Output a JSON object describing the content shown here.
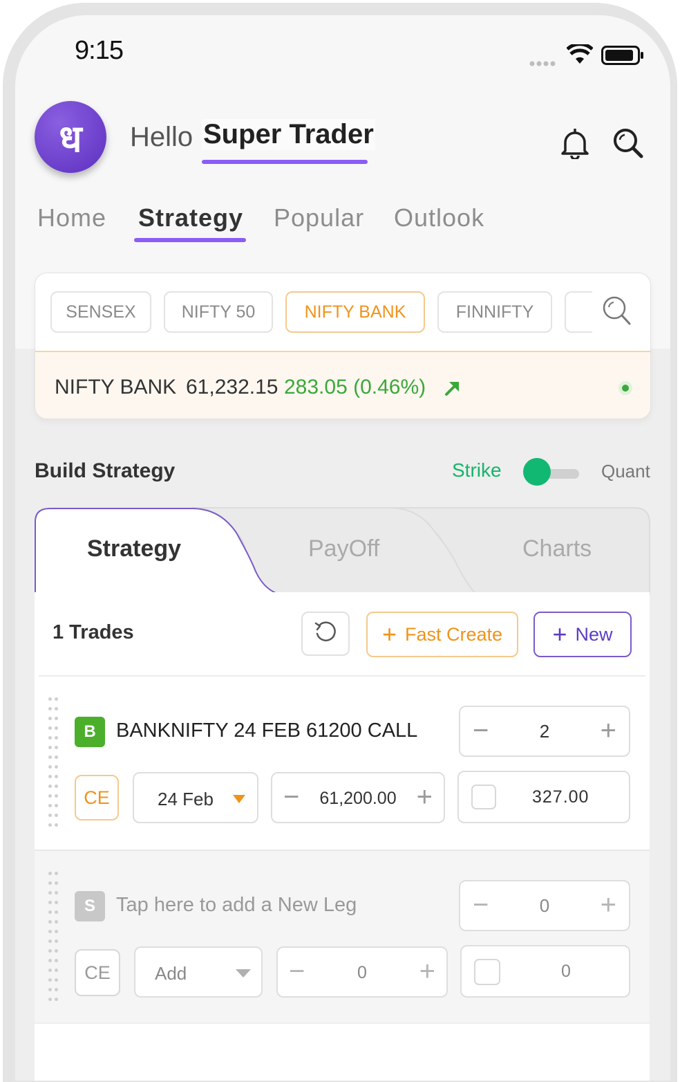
{
  "status_bar": {
    "time": "9:15"
  },
  "header": {
    "avatar_letter": "ध",
    "greeting": "Hello",
    "user_name": "Super Trader"
  },
  "nav": {
    "tabs": [
      {
        "label": "Home",
        "active": false
      },
      {
        "label": "Strategy",
        "active": true
      },
      {
        "label": "Popular",
        "active": false
      },
      {
        "label": "Outlook",
        "active": false
      }
    ]
  },
  "indices": {
    "chips": [
      {
        "label": "SENSEX",
        "active": false
      },
      {
        "label": "NIFTY 50",
        "active": false
      },
      {
        "label": "NIFTY BANK",
        "active": true
      },
      {
        "label": "FINNIFTY",
        "active": false
      }
    ],
    "ticker": {
      "name": "NIFTY BANK",
      "price": "61,232.15",
      "change": "283.05 (0.46%)"
    }
  },
  "build": {
    "title": "Build Strategy",
    "toggle_left": "Strike",
    "toggle_right": "Quant",
    "tabs": [
      {
        "label": "Strategy",
        "active": true
      },
      {
        "label": "PayOff",
        "active": false
      },
      {
        "label": "Charts",
        "active": false
      }
    ],
    "trades_label": "1 Trades",
    "fast_create_label": "Fast Create",
    "new_label": "New"
  },
  "legs": [
    {
      "badge": "B",
      "title": "BANKNIFTY 24 FEB 61200 CALL",
      "lots": "2",
      "type": "CE",
      "expiry": "24 Feb",
      "strike": "61,200.00",
      "premium": "327.00"
    },
    {
      "badge": "S",
      "title": "Tap here to add a New Leg",
      "lots": "0",
      "type": "CE",
      "expiry": "Add",
      "strike": "0",
      "premium": "0"
    }
  ],
  "colors": {
    "accent": "#8b5cf6",
    "orange": "#f0931a",
    "green": "#3aa83a",
    "toggle_green": "#11b872",
    "buy_badge": "#4caf2c",
    "sell_badge": "#c8c8c8"
  }
}
